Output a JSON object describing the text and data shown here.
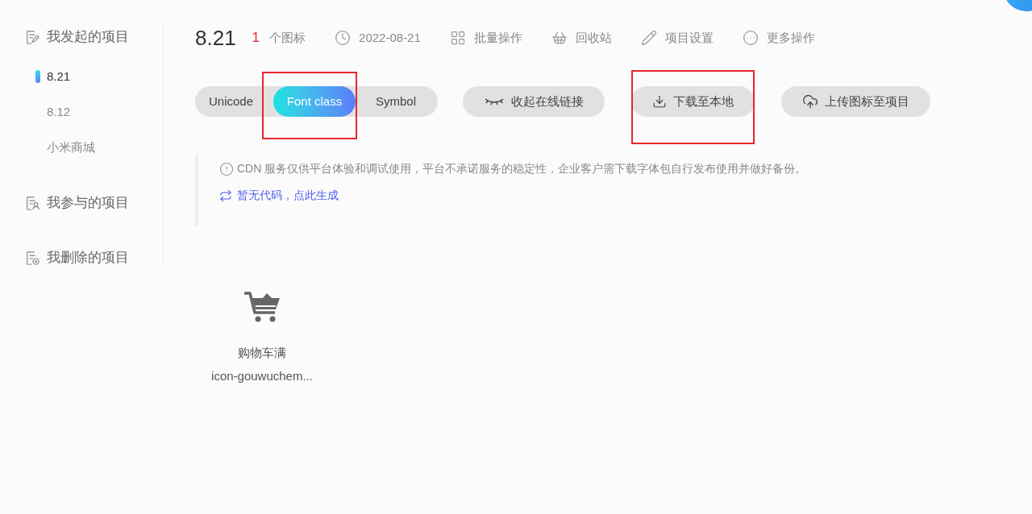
{
  "sidebar": {
    "groups": [
      {
        "kind": "created",
        "label": "我发起的项目",
        "items": [
          {
            "label": "8.21",
            "selected": true
          },
          {
            "label": "8.12",
            "selected": false
          },
          {
            "label": "小米商城",
            "selected": false
          }
        ]
      },
      {
        "kind": "joined",
        "label": "我参与的项目"
      },
      {
        "kind": "deleted",
        "label": "我删除的项目"
      }
    ]
  },
  "project": {
    "name": "8.21",
    "icon_count": "1",
    "icon_count_label": "个图标",
    "toolbar": [
      {
        "kind": "date",
        "label": "2022-08-21"
      },
      {
        "kind": "batch",
        "label": "批量操作"
      },
      {
        "kind": "trash",
        "label": "回收站"
      },
      {
        "kind": "settings",
        "label": "项目设置"
      },
      {
        "kind": "more",
        "label": "更多操作"
      }
    ]
  },
  "format_tabs": [
    {
      "label": "Unicode",
      "selected": false,
      "annotated": false
    },
    {
      "label": "Font class",
      "selected": true,
      "annotated": true
    },
    {
      "label": "Symbol",
      "selected": false,
      "annotated": false
    }
  ],
  "actions": [
    {
      "kind": "collapse",
      "label": "收起在线链接",
      "annotated": false
    },
    {
      "kind": "download",
      "label": "下载至本地",
      "annotated": true
    },
    {
      "kind": "upload",
      "label": "上传图标至项目",
      "annotated": false
    }
  ],
  "notice": {
    "text": "CDN 服务仅供平台体验和调试使用，平台不承诺服务的稳定性，企业客户需下载字体包自行发布使用并做好备份。",
    "link": "暂无代码，点此生成"
  },
  "icons": [
    {
      "name": "购物车满",
      "code": "icon-gouwuchem..."
    }
  ]
}
